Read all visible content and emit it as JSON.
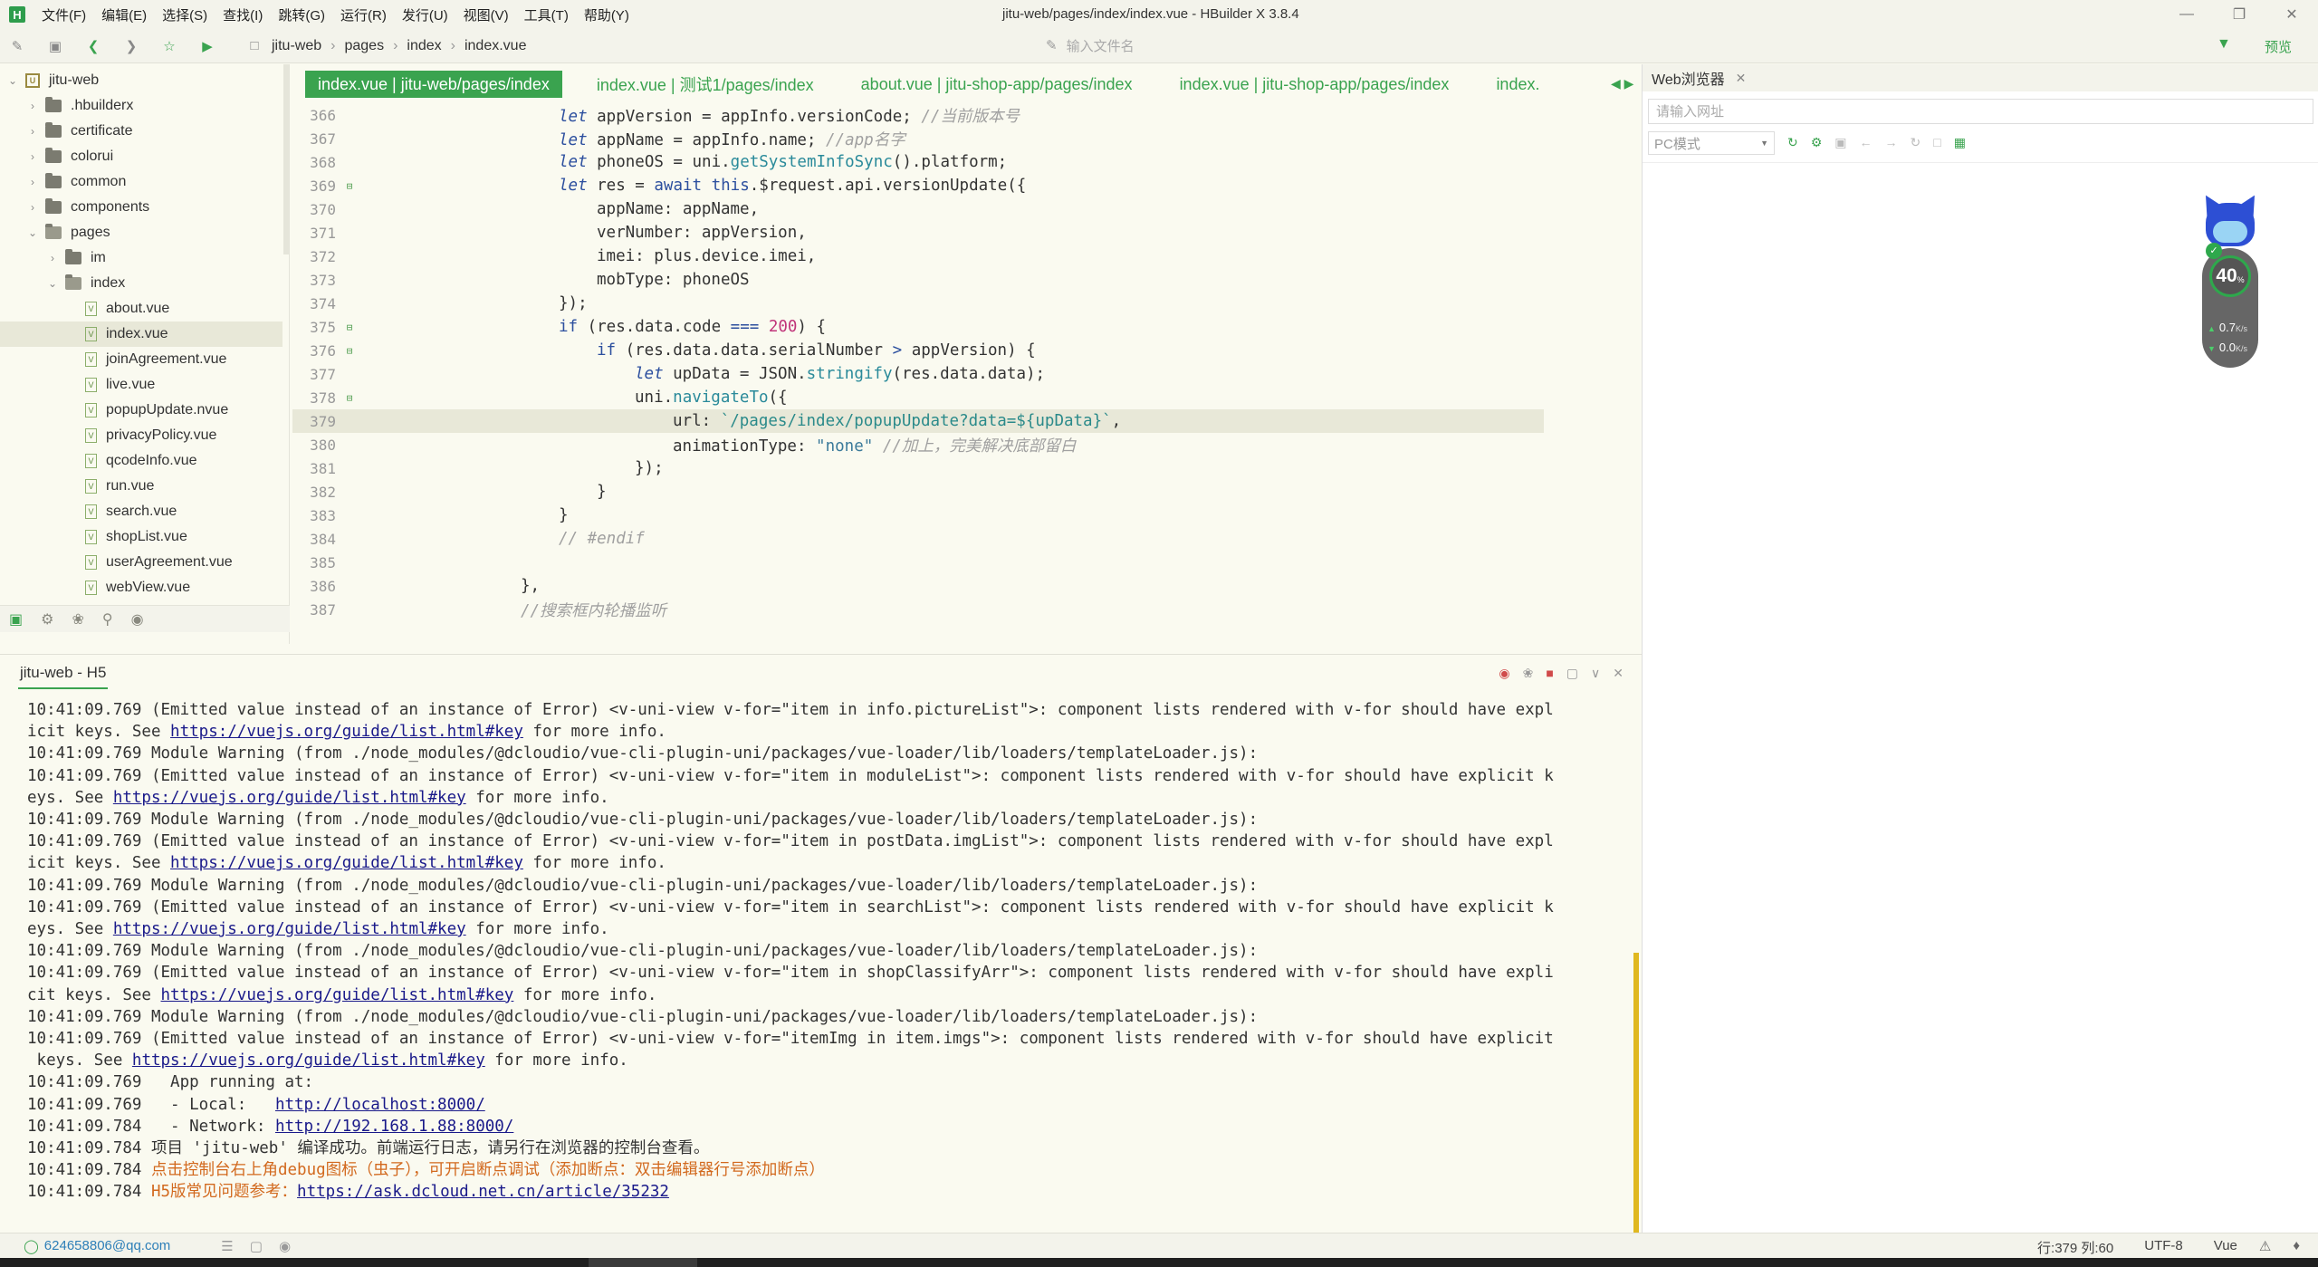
{
  "menu": {
    "logo_letter": "H",
    "items": [
      "文件(F)",
      "编辑(E)",
      "选择(S)",
      "查找(I)",
      "跳转(G)",
      "运行(R)",
      "发行(U)",
      "视图(V)",
      "工具(T)",
      "帮助(Y)"
    ]
  },
  "window_title": "jitu-web/pages/index/index.vue - HBuilder X 3.8.4",
  "toolbar": {
    "breadcrumb": [
      "jitu-web",
      "pages",
      "index",
      "index.vue"
    ],
    "file_search_placeholder": "输入文件名",
    "preview_label": "预览"
  },
  "sidebar": {
    "tree": [
      {
        "label": "jitu-web",
        "type": "project",
        "depth": 0,
        "expanded": true
      },
      {
        "label": ".hbuilderx",
        "type": "folder",
        "depth": 1
      },
      {
        "label": "certificate",
        "type": "folder",
        "depth": 1
      },
      {
        "label": "colorui",
        "type": "folder",
        "depth": 1
      },
      {
        "label": "common",
        "type": "folder",
        "depth": 1
      },
      {
        "label": "components",
        "type": "folder",
        "depth": 1
      },
      {
        "label": "pages",
        "type": "folder",
        "depth": 1,
        "expanded": true
      },
      {
        "label": "im",
        "type": "folder",
        "depth": 2
      },
      {
        "label": "index",
        "type": "folder",
        "depth": 2,
        "expanded": true
      },
      {
        "label": "about.vue",
        "type": "file",
        "depth": 3
      },
      {
        "label": "index.vue",
        "type": "file",
        "depth": 3,
        "selected": true
      },
      {
        "label": "joinAgreement.vue",
        "type": "file",
        "depth": 3
      },
      {
        "label": "live.vue",
        "type": "file",
        "depth": 3
      },
      {
        "label": "popupUpdate.nvue",
        "type": "file",
        "depth": 3
      },
      {
        "label": "privacyPolicy.vue",
        "type": "file",
        "depth": 3
      },
      {
        "label": "qcodeInfo.vue",
        "type": "file",
        "depth": 3
      },
      {
        "label": "run.vue",
        "type": "file",
        "depth": 3
      },
      {
        "label": "search.vue",
        "type": "file",
        "depth": 3
      },
      {
        "label": "shopList.vue",
        "type": "file",
        "depth": 3
      },
      {
        "label": "userAgreement.vue",
        "type": "file",
        "depth": 3
      },
      {
        "label": "webView.vue",
        "type": "file",
        "depth": 3
      }
    ]
  },
  "editor": {
    "tabs": [
      {
        "label": "index.vue | jitu-web/pages/index",
        "active": true
      },
      {
        "label": "index.vue | 测试1/pages/index"
      },
      {
        "label": "about.vue | jitu-shop-app/pages/index"
      },
      {
        "label": "index.vue | jitu-shop-app/pages/index"
      },
      {
        "label": "index."
      }
    ],
    "lines": [
      {
        "n": "366",
        "fold": false
      },
      {
        "n": "367",
        "fold": false
      },
      {
        "n": "368",
        "fold": false
      },
      {
        "n": "369",
        "fold": true
      },
      {
        "n": "370",
        "fold": false
      },
      {
        "n": "371",
        "fold": false
      },
      {
        "n": "372",
        "fold": false
      },
      {
        "n": "373",
        "fold": false
      },
      {
        "n": "374",
        "fold": false
      },
      {
        "n": "375",
        "fold": true
      },
      {
        "n": "376",
        "fold": true
      },
      {
        "n": "377",
        "fold": false
      },
      {
        "n": "378",
        "fold": true
      },
      {
        "n": "379",
        "fold": false,
        "current": true
      },
      {
        "n": "380",
        "fold": false
      },
      {
        "n": "381",
        "fold": false
      },
      {
        "n": "382",
        "fold": false
      },
      {
        "n": "383",
        "fold": false
      },
      {
        "n": "384",
        "fold": false
      },
      {
        "n": "385",
        "fold": false
      },
      {
        "n": "386",
        "fold": false
      },
      {
        "n": "387",
        "fold": false
      }
    ],
    "code": {
      "l366a": "let",
      "l366b": " appVersion = appInfo.versionCode; ",
      "l366c": "//当前版本号",
      "l367a": "let",
      "l367b": " appName = appInfo.name; ",
      "l367c": "//app名字",
      "l368a": "let",
      "l368b": " phoneOS = uni.",
      "l368c": "getSystemInfoSync",
      "l368d": "().platform;",
      "l369a": "let",
      "l369b": " res = ",
      "l369c": "await",
      "l369d": " ",
      "l369e": "this",
      "l369f": ".$request.api.versionUpdate({",
      "l370": "appName: appName,",
      "l371": "verNumber: appVersion,",
      "l372": "imei: plus.device.imei,",
      "l373": "mobType: phoneOS",
      "l374": "});",
      "l375a": "if",
      "l375b": " (res.data.code ",
      "l375c": "===",
      "l375d": " ",
      "l375e": "200",
      "l375f": ") {",
      "l376a": "if",
      "l376b": " (res.data.data.serialNumber ",
      "l376c": ">",
      "l376d": " appVersion) {",
      "l377a": "let",
      "l377b": " upData = JSON.",
      "l377c": "stringify",
      "l377d": "(res.data.data);",
      "l378a": "uni.",
      "l378b": "navigateTo",
      "l378c": "({",
      "l379a": "url: ",
      "l379b": "`/pages/index/popupUpdate?data=${upData}`",
      "l379c": ",",
      "l380a": "animationType: ",
      "l380b": "\"none\"",
      "l380c": " ",
      "l380d": "//加上，完美解决底部留白",
      "l381": "});",
      "l382": "}",
      "l383": "}",
      "l384": "// #endif",
      "l385": "",
      "l386": "},",
      "l387": "//搜索框内轮播监听"
    }
  },
  "console": {
    "title": "jitu-web - H5",
    "lines": [
      {
        "pre": "10:41:09.769 (Emitted value instead of an instance of Error) <v-uni-view v-for=\"item in info.pictureList\">: component lists rendered with v-for should have expl"
      },
      {
        "pre": "icit keys. See ",
        "link": "https://vuejs.org/guide/list.html#key",
        "post": " for more info."
      },
      {
        "pre": "10:41:09.769 Module Warning (from ./node_modules/@dcloudio/vue-cli-plugin-uni/packages/vue-loader/lib/loaders/templateLoader.js):"
      },
      {
        "pre": "10:41:09.769 (Emitted value instead of an instance of Error) <v-uni-view v-for=\"item in moduleList\">: component lists rendered with v-for should have explicit k"
      },
      {
        "pre": "eys. See ",
        "link": "https://vuejs.org/guide/list.html#key",
        "post": " for more info."
      },
      {
        "pre": "10:41:09.769 Module Warning (from ./node_modules/@dcloudio/vue-cli-plugin-uni/packages/vue-loader/lib/loaders/templateLoader.js):"
      },
      {
        "pre": "10:41:09.769 (Emitted value instead of an instance of Error) <v-uni-view v-for=\"item in postData.imgList\">: component lists rendered with v-for should have expl"
      },
      {
        "pre": "icit keys. See ",
        "link": "https://vuejs.org/guide/list.html#key",
        "post": " for more info."
      },
      {
        "pre": "10:41:09.769 Module Warning (from ./node_modules/@dcloudio/vue-cli-plugin-uni/packages/vue-loader/lib/loaders/templateLoader.js):"
      },
      {
        "pre": "10:41:09.769 (Emitted value instead of an instance of Error) <v-uni-view v-for=\"item in searchList\">: component lists rendered with v-for should have explicit k"
      },
      {
        "pre": "eys. See ",
        "link": "https://vuejs.org/guide/list.html#key",
        "post": " for more info."
      },
      {
        "pre": "10:41:09.769 Module Warning (from ./node_modules/@dcloudio/vue-cli-plugin-uni/packages/vue-loader/lib/loaders/templateLoader.js):"
      },
      {
        "pre": "10:41:09.769 (Emitted value instead of an instance of Error) <v-uni-view v-for=\"item in shopClassifyArr\">: component lists rendered with v-for should have expli"
      },
      {
        "pre": "cit keys. See ",
        "link": "https://vuejs.org/guide/list.html#key",
        "post": " for more info."
      },
      {
        "pre": "10:41:09.769 Module Warning (from ./node_modules/@dcloudio/vue-cli-plugin-uni/packages/vue-loader/lib/loaders/templateLoader.js):"
      },
      {
        "pre": "10:41:09.769 (Emitted value instead of an instance of Error) <v-uni-view v-for=\"itemImg in item.imgs\">: component lists rendered with v-for should have explicit"
      },
      {
        "pre": " keys. See ",
        "link": "https://vuejs.org/guide/list.html#key",
        "post": " for more info."
      },
      {
        "pre": "10:41:09.769   App running at:"
      },
      {
        "pre": "10:41:09.769   - Local:   ",
        "link": "http://localhost:8000/"
      },
      {
        "pre": "10:41:09.784   - Network: ",
        "link": "http://192.168.1.88:8000/"
      },
      {
        "pre": "10:41:09.784 项目 'jitu-web' 编译成功。前端运行日志，请另行在浏览器的控制台查看。"
      },
      {
        "pre": "10:41:09.784 ",
        "orange": "点击控制台右上角debug图标（虫子），可开启断点调试（添加断点：双击编辑器行号添加断点）"
      },
      {
        "pre": "10:41:09.784 ",
        "orange": "H5版常见问题参考：",
        "link": "https://ask.dcloud.net.cn/article/35232"
      }
    ]
  },
  "browser": {
    "tab_label": "Web浏览器",
    "url_placeholder": "请输入网址",
    "mode": "PC模式"
  },
  "speed_widget": {
    "percent": "40",
    "percent_unit": "%",
    "upload": "0.7",
    "download": "0.0",
    "rate_unit": "K/s"
  },
  "status": {
    "user": "624658806@qq.com",
    "position": "行:379  列:60",
    "encoding": "UTF-8",
    "language": "Vue"
  },
  "colors": {
    "accent": "#3aa34f",
    "background": "#fafaf0",
    "link": "#1a1a8a",
    "warning_text": "#d2691e"
  }
}
